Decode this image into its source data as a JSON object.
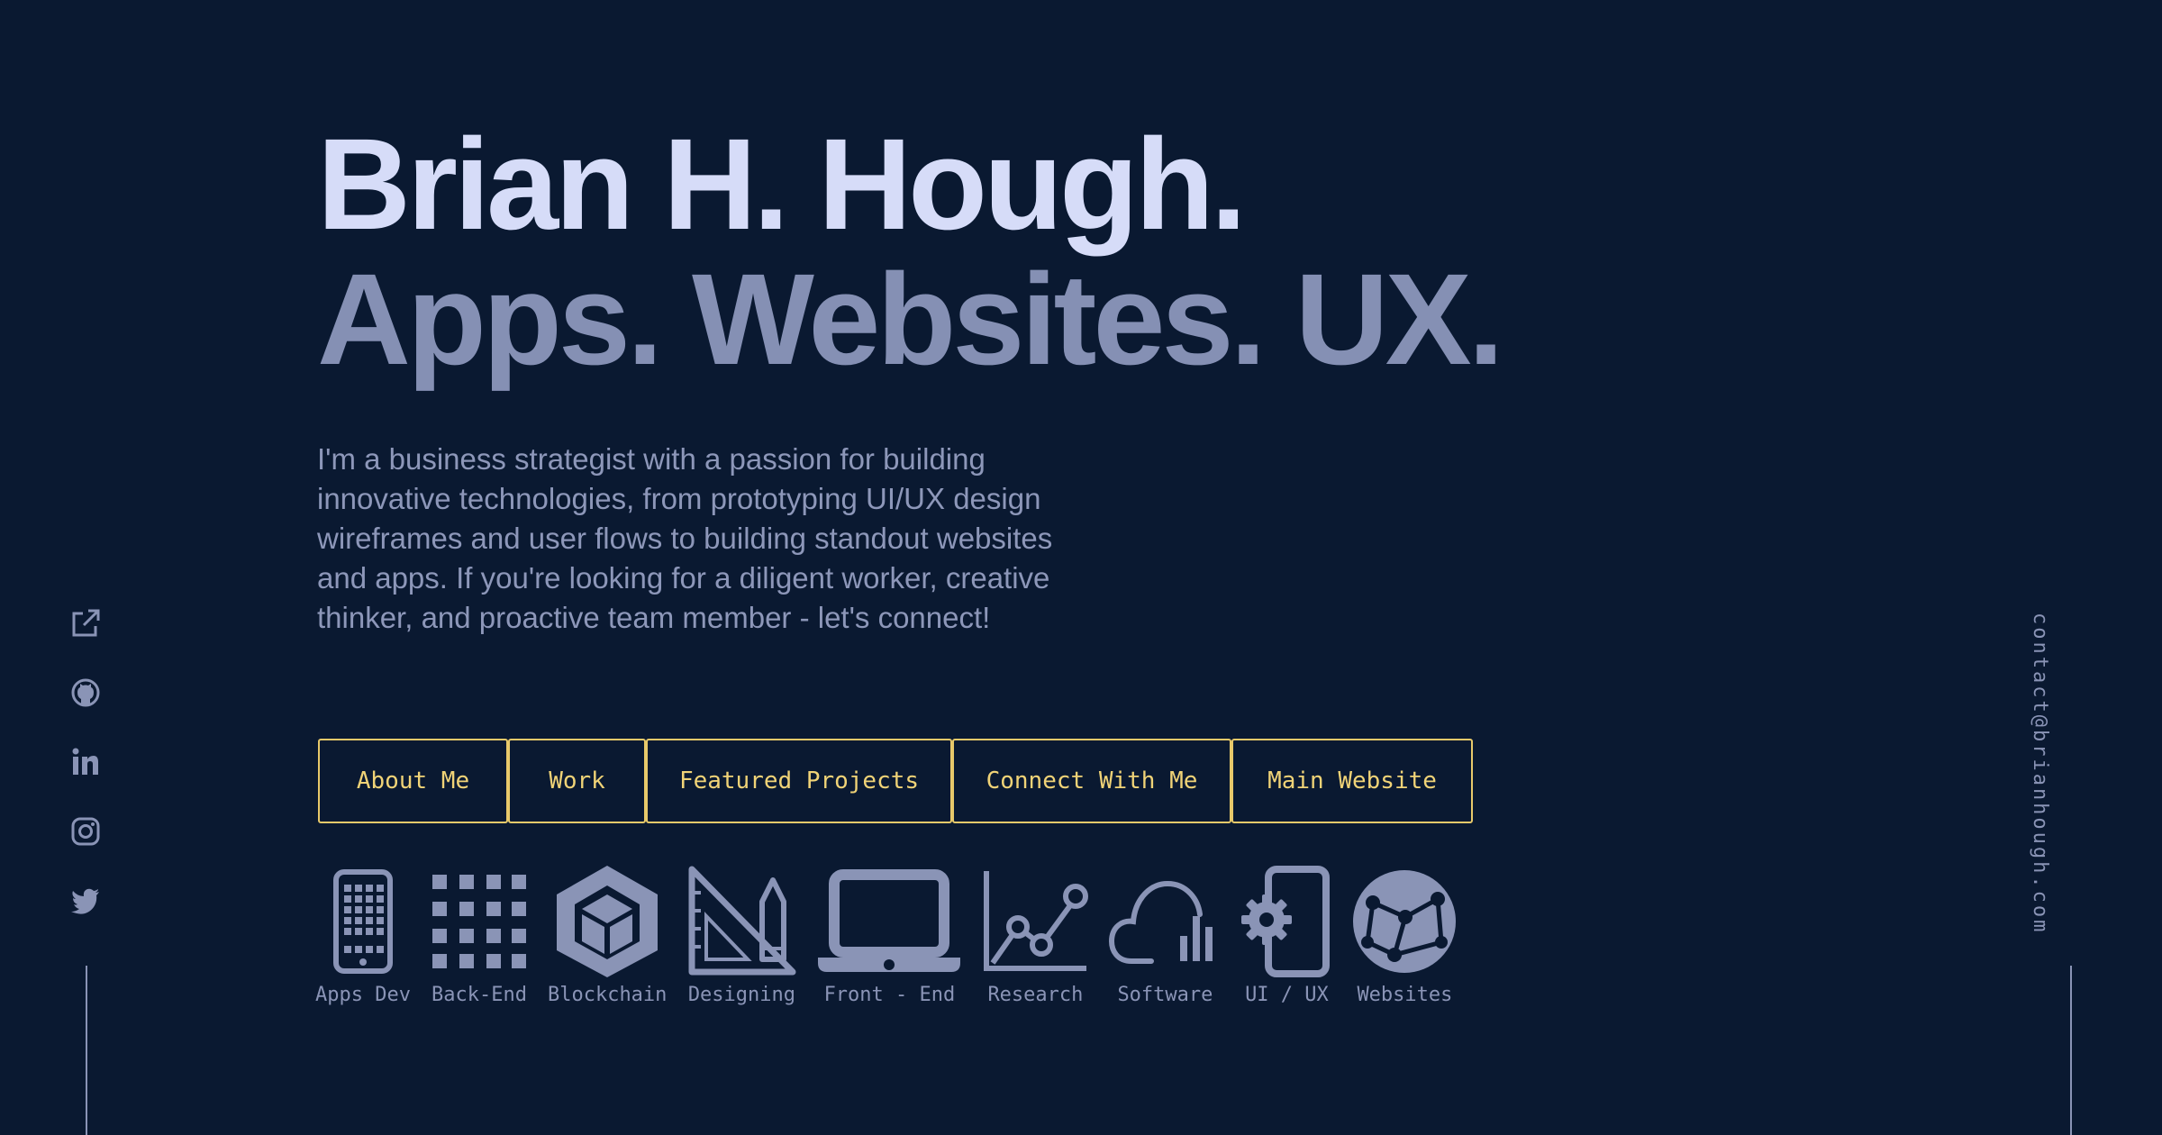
{
  "hero": {
    "name": "Brian H. Hough.",
    "tagline": "Apps. Websites. UX.",
    "bio": "I'm a business strategist with a passion for building innovative technologies, from prototyping UI/UX design wireframes and user flows to building standout websites and apps. If you're looking for a diligent worker, creative thinker, and proactive team member - let's connect!"
  },
  "nav": {
    "about": "About Me",
    "work": "Work",
    "featured": "Featured Projects",
    "connect": "Connect With Me",
    "main": "Main Website"
  },
  "skills": {
    "apps": "Apps Dev",
    "backend": "Back-End",
    "blockchain": "Blockchain",
    "designing": "Designing",
    "frontend": "Front - End",
    "research": "Research",
    "software": "Software",
    "uiux": "UI / UX",
    "websites": "Websites"
  },
  "social": {
    "icons": [
      "external-link-icon",
      "github-icon",
      "linkedin-icon",
      "instagram-icon",
      "twitter-icon"
    ]
  },
  "contact": {
    "email": "contact@brianhough.com"
  },
  "colors": {
    "background": "#0a1931",
    "name": "#d6dcf8",
    "tagline": "#8590b4",
    "accent": "#f0d377",
    "muted": "#8a94b6"
  }
}
